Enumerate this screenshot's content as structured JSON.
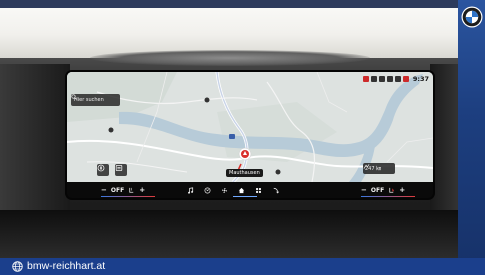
{
  "brand": {
    "name": "BMW",
    "accent": "#1b3f8c"
  },
  "footer": {
    "website": "bmw-reichhart.at"
  },
  "screen": {
    "status_bar": {
      "time": "9:37"
    },
    "search": {
      "placeholder": "Hier suchen"
    },
    "map": {
      "destination_label": "Mauthausen",
      "range_label": "247 ㎞"
    },
    "climate_left": {
      "minus": "−",
      "state": "OFF",
      "plus": "+"
    },
    "climate_right": {
      "minus": "−",
      "state": "OFF",
      "plus": "+"
    },
    "menu": [
      "music-note-icon",
      "phone-icon",
      "fan-icon",
      "home-icon",
      "apps-grid-icon",
      "navigation-arrow-icon"
    ]
  }
}
